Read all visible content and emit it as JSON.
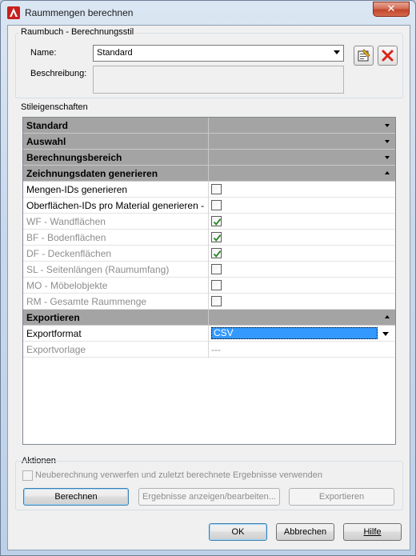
{
  "window": {
    "title": "Raummengen berechnen",
    "close_label": "✕"
  },
  "style_group": {
    "label": "Raumbuch - Berechnungsstil",
    "name_label": "Name:",
    "name_value": "Standard",
    "description_label": "Beschreibung:",
    "description_value": ""
  },
  "properties": {
    "label": "Stileigenschaften",
    "rows": [
      {
        "name": "Standard",
        "type": "category",
        "expanded": false
      },
      {
        "name": "Auswahl",
        "type": "category",
        "expanded": false
      },
      {
        "name": "Berechnungsbereich",
        "type": "category",
        "expanded": false
      },
      {
        "name": "Zeichnungsdaten generieren",
        "type": "category",
        "expanded": true
      },
      {
        "name": "Mengen-IDs generieren",
        "type": "checkbox",
        "checked": false,
        "disabled": false
      },
      {
        "name": "Oberflächen-IDs pro Material generieren -",
        "type": "checkbox",
        "checked": false,
        "disabled": false
      },
      {
        "name": "WF - Wandflächen",
        "type": "checkbox",
        "checked": true,
        "disabled": true
      },
      {
        "name": "BF - Bodenflächen",
        "type": "checkbox",
        "checked": true,
        "disabled": true
      },
      {
        "name": "DF - Deckenflächen",
        "type": "checkbox",
        "checked": true,
        "disabled": true
      },
      {
        "name": "SL - Seitenlängen (Raumumfang)",
        "type": "checkbox",
        "checked": false,
        "disabled": true
      },
      {
        "name": "MO - Möbelobjekte",
        "type": "checkbox",
        "checked": false,
        "disabled": true
      },
      {
        "name": "RM - Gesamte Raummenge",
        "type": "checkbox",
        "checked": false,
        "disabled": true
      },
      {
        "name": "Exportieren",
        "type": "category",
        "expanded": true
      },
      {
        "name": "Exportformat",
        "type": "select",
        "value": "CSV",
        "disabled": false
      },
      {
        "name": "Exportvorlage",
        "type": "text",
        "value": "---",
        "disabled": true
      }
    ]
  },
  "actions": {
    "label": "Aktionen",
    "discard_checkbox_label": "Neuberechnung verwerfen und zuletzt berechnete Ergebnisse verwenden",
    "calculate_label": "Berechnen",
    "show_results_label": "Ergebnisse anzeigen/bearbeiten...",
    "export_label": "Exportieren"
  },
  "footer": {
    "ok_label": "OK",
    "cancel_label": "Abbrechen",
    "help_label": "Hilfe"
  },
  "colors": {
    "category_row": "#a4a4a4",
    "selection": "#3399ff",
    "check_green": "#2f8a2f",
    "delete_red": "#d8261c"
  }
}
